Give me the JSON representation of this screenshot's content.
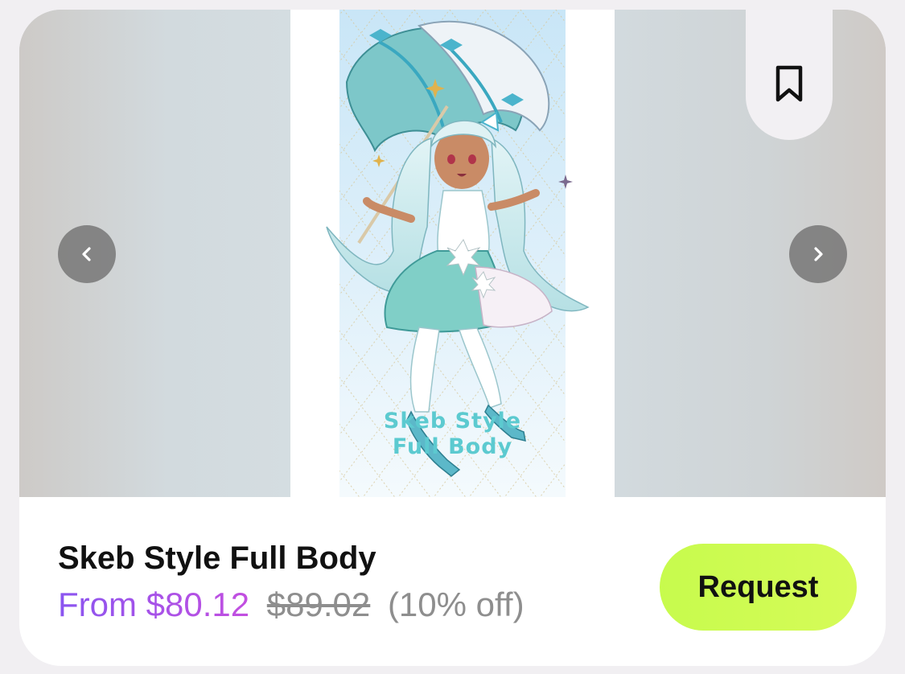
{
  "product": {
    "title": "Skeb Style Full Body",
    "price_current": "From $80.12",
    "price_original": "$89.02",
    "discount": "(10% off)"
  },
  "gallery": {
    "artwork_caption": "Skeb  Style\nFull  Body",
    "prev_icon": "chevron-left-icon",
    "next_icon": "chevron-right-icon",
    "bookmark_icon": "bookmark-icon"
  },
  "actions": {
    "request_label": "Request"
  },
  "colors": {
    "price_gradient_start": "#8a55f0",
    "price_gradient_end": "#c34fe0",
    "request_button": "#cdfb50",
    "caption_teal": "#5ccad0"
  }
}
